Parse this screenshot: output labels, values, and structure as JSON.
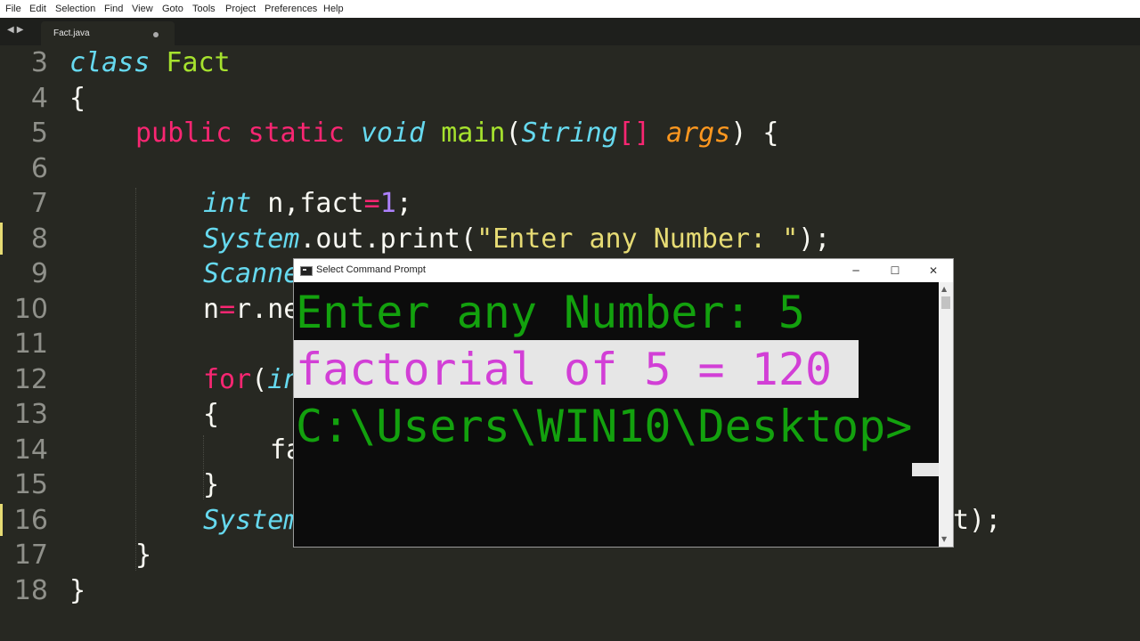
{
  "menu": [
    "File",
    "Edit",
    "Selection",
    "Find",
    "View",
    "Goto",
    "Tools",
    "Project",
    "Preferences",
    "Help"
  ],
  "tab": {
    "filename": "Fact.java"
  },
  "editor": {
    "line_numbers": [
      "3",
      "4",
      "5",
      "6",
      "7",
      "8",
      "9",
      "10",
      "11",
      "12",
      "13",
      "14",
      "15",
      "16",
      "17",
      "18"
    ],
    "lines": {
      "l3": [
        "class",
        "Fact"
      ],
      "l4": "{",
      "l5": [
        "public",
        "static",
        "void",
        "main",
        "(",
        "String",
        "[]",
        "args",
        ") {"
      ],
      "l7": [
        "int",
        " n,fact",
        "=",
        "1",
        ";"
      ],
      "l8": [
        "System",
        ".out.print(",
        "\"Enter any Number: \"",
        ");"
      ],
      "l9": "Scanne",
      "l10": [
        "n",
        "=",
        "r.ne"
      ],
      "l12": [
        "for",
        "(",
        "in"
      ],
      "l13": "{",
      "l14": "fa",
      "l15": "}",
      "l16": [
        "System",
        "t);"
      ],
      "l17": "}",
      "l18": "}"
    }
  },
  "cmd": {
    "title": "Select Command Prompt",
    "buttons": {
      "minimize": "─",
      "maximize": "☐",
      "close": "✕"
    },
    "output": [
      "Enter any Number: 5",
      "factorial of 5 = 120",
      "C:\\Users\\WIN10\\Desktop>"
    ]
  },
  "colors": {
    "editor_bg": "#272822",
    "keyword": "#f92672",
    "type_italic": "#66d9ef",
    "function": "#a6e22e",
    "string": "#e6db74",
    "number": "#ae81ff",
    "argument": "#fd971f",
    "cmd_green": "#13a10e",
    "cmd_magenta": "#d23fd6"
  },
  "icons": [
    "nav-arrows-icon",
    "unsaved-dot-icon",
    "cmd-window-icon",
    "minimize-icon",
    "maximize-icon",
    "close-icon",
    "scroll-up-icon",
    "scroll-down-icon"
  ]
}
